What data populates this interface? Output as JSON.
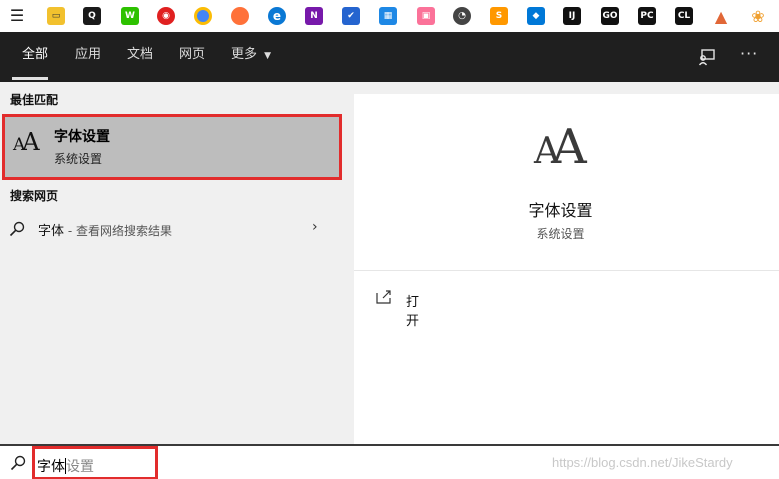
{
  "taskbar": {
    "icons": [
      {
        "name": "task-view-icon",
        "glyph": "☰",
        "color": "#222222"
      },
      {
        "name": "file-explorer-icon",
        "glyph": "▭",
        "color": "#f2c12e"
      },
      {
        "name": "qq-icon",
        "glyph": "Q",
        "color": "#1a1a1a"
      },
      {
        "name": "wechat-icon",
        "glyph": "W",
        "color": "#2dc100"
      },
      {
        "name": "netease-music-icon",
        "glyph": "◉",
        "color": "#e02020"
      },
      {
        "name": "chrome-icon",
        "glyph": "●",
        "color": "#4285f4"
      },
      {
        "name": "firefox-icon",
        "glyph": "●",
        "color": "#ff7139"
      },
      {
        "name": "edge-icon",
        "glyph": "e",
        "color": "#0a78d4"
      },
      {
        "name": "onenote-icon",
        "glyph": "N",
        "color": "#7719aa"
      },
      {
        "name": "todo-icon",
        "glyph": "✔",
        "color": "#2564cf"
      },
      {
        "name": "calendar-icon",
        "glyph": "▦",
        "color": "#1e88e5"
      },
      {
        "name": "bilibili-icon",
        "glyph": "▣",
        "color": "#fb7299"
      },
      {
        "name": "clock-icon",
        "glyph": "◔",
        "color": "#444444"
      },
      {
        "name": "sublime-icon",
        "glyph": "S",
        "color": "#ff9800"
      },
      {
        "name": "vscode-icon",
        "glyph": "◆",
        "color": "#0078d7"
      },
      {
        "name": "intellij-icon",
        "glyph": "IJ",
        "color": "#111111"
      },
      {
        "name": "goland-icon",
        "glyph": "GO",
        "color": "#111111"
      },
      {
        "name": "pycharm-icon",
        "glyph": "PC",
        "color": "#111111"
      },
      {
        "name": "clion-icon",
        "glyph": "CL",
        "color": "#111111"
      },
      {
        "name": "matlab-icon",
        "glyph": "▲",
        "color": "#e16737"
      },
      {
        "name": "photos-icon",
        "glyph": "❀",
        "color": "#f0a030"
      }
    ]
  },
  "header": {
    "tabs": [
      "全部",
      "应用",
      "文档",
      "网页",
      "更多"
    ],
    "more_arrow": "▼",
    "feedback_icon": "feedback-icon",
    "options_glyph": "···"
  },
  "results": {
    "best_match_heading": "最佳匹配",
    "best_match": {
      "title": "字体设置",
      "subtitle": "系统设置",
      "icon": "font-aa-icon"
    },
    "web_heading": "搜索网页",
    "web_item": {
      "query": "字体",
      "suffix": " - 查看网络搜索结果",
      "arrow": "›"
    }
  },
  "detail": {
    "title": "字体设置",
    "subtitle": "系统设置",
    "action_label": "打开"
  },
  "search": {
    "value": "字体",
    "suggestion": "设置"
  },
  "watermark": "https://blog.csdn.net/JikeStardy",
  "colors": {
    "header_bg": "#1f1f1f",
    "selection_bg": "#bdbdbd",
    "highlight_border": "#e22c2c"
  }
}
